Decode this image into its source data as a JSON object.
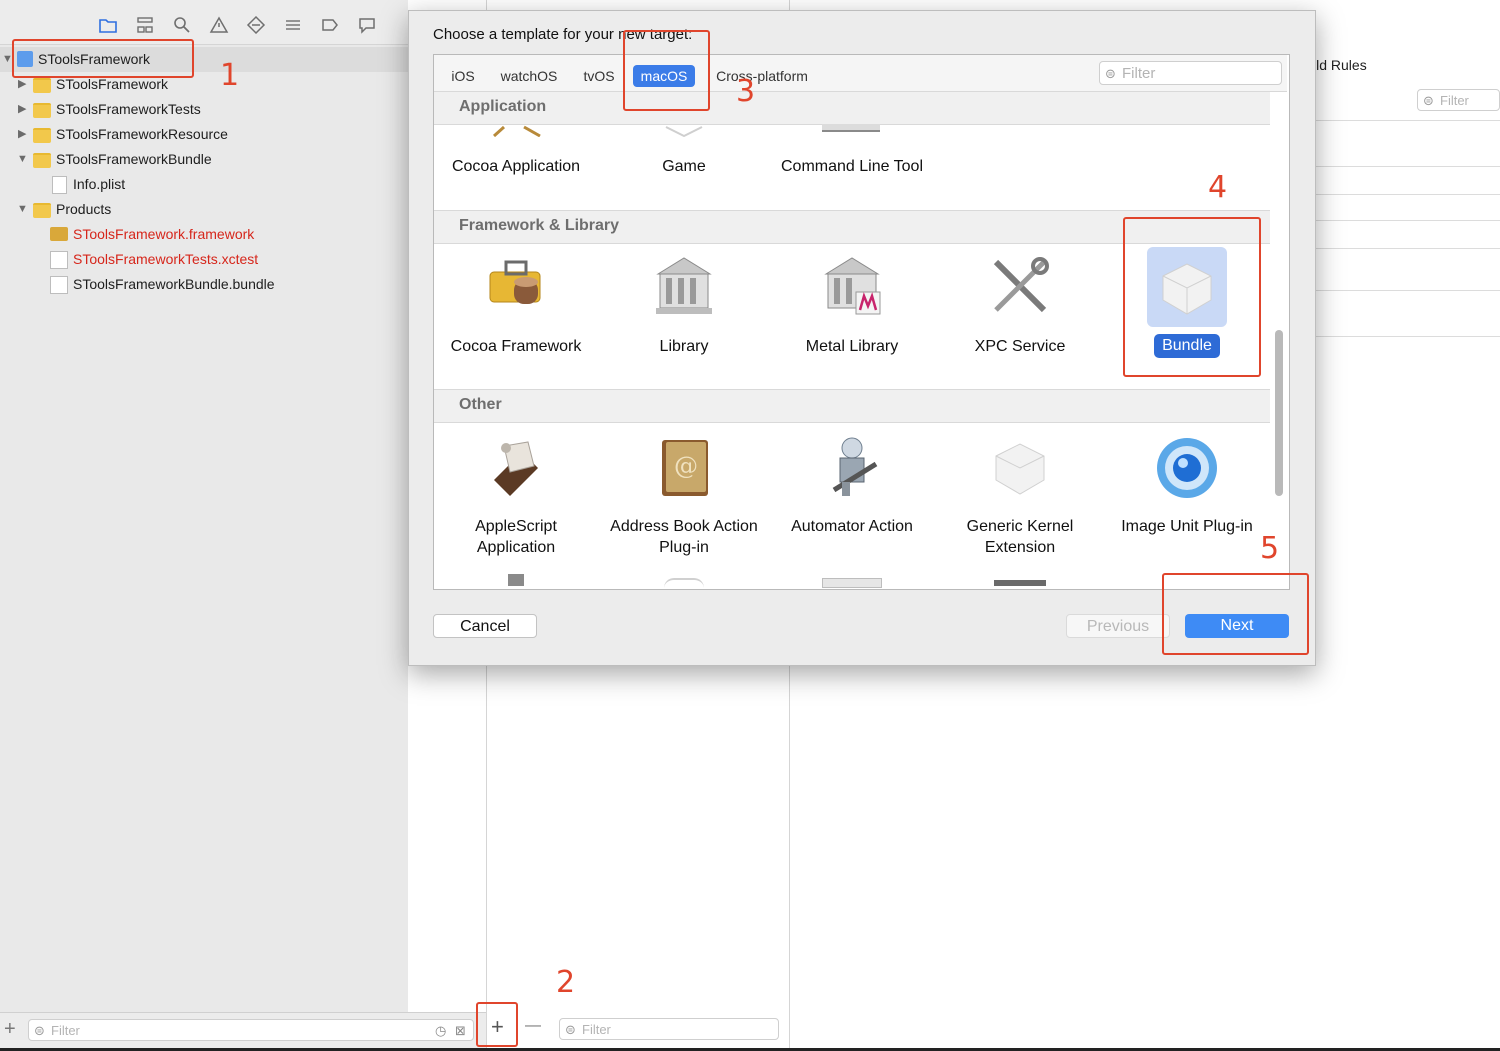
{
  "navigator": {
    "tools": [
      "folder-icon",
      "hierarchy-icon",
      "search-icon",
      "warning-icon",
      "test-diamond-icon",
      "debug-list-icon",
      "breakpoint-icon",
      "report-icon"
    ],
    "tree": [
      {
        "label": "SToolsFramework",
        "kind": "project",
        "red": false
      },
      {
        "label": "SToolsFramework",
        "kind": "folder",
        "red": false
      },
      {
        "label": "SToolsFrameworkTests",
        "kind": "folder",
        "red": false
      },
      {
        "label": "SToolsFrameworkResource",
        "kind": "folder",
        "red": false
      },
      {
        "label": "SToolsFrameworkBundle",
        "kind": "folder",
        "red": false
      },
      {
        "label": "Info.plist",
        "kind": "file",
        "red": false
      },
      {
        "label": "Products",
        "kind": "folder",
        "red": false
      },
      {
        "label": "SToolsFramework.framework",
        "kind": "framework",
        "red": true
      },
      {
        "label": "SToolsFrameworkTests.xctest",
        "kind": "file",
        "red": true
      },
      {
        "label": "SToolsFrameworkBundle.bundle",
        "kind": "file",
        "red": false
      }
    ],
    "filter_placeholder": "Filter"
  },
  "targets": {
    "filter_placeholder": "Filter",
    "add_symbol": "+",
    "remove_symbol": "—"
  },
  "right_pane": {
    "tab_partial": "ild Rules",
    "filter_placeholder": "Filter"
  },
  "dialog": {
    "title": "Choose a template for your new target:",
    "tabs": [
      "iOS",
      "watchOS",
      "tvOS",
      "macOS",
      "Cross-platform"
    ],
    "active_tab": "macOS",
    "filter_placeholder": "Filter",
    "sections": {
      "application": {
        "title": "Application",
        "items": [
          {
            "label": "Cocoa Application"
          },
          {
            "label": "Game"
          },
          {
            "label": "Command Line Tool"
          }
        ]
      },
      "framework": {
        "title": "Framework & Library",
        "items": [
          {
            "label": "Cocoa Framework"
          },
          {
            "label": "Library"
          },
          {
            "label": "Metal Library"
          },
          {
            "label": "XPC Service"
          },
          {
            "label": "Bundle"
          }
        ],
        "selected": "Bundle"
      },
      "other": {
        "title": "Other",
        "items": [
          {
            "label": "AppleScript Application"
          },
          {
            "label": "Address Book Action Plug-in"
          },
          {
            "label": "Automator Action"
          },
          {
            "label": "Generic Kernel Extension"
          },
          {
            "label": "Image Unit Plug-in"
          }
        ]
      }
    },
    "buttons": {
      "cancel": "Cancel",
      "previous": "Previous",
      "next": "Next"
    }
  },
  "annotations": [
    "1",
    "2",
    "3",
    "4",
    "5"
  ],
  "colors": {
    "accent": "#3b7ce8",
    "annotation": "#e0452c",
    "missing_file": "#d6261b"
  }
}
